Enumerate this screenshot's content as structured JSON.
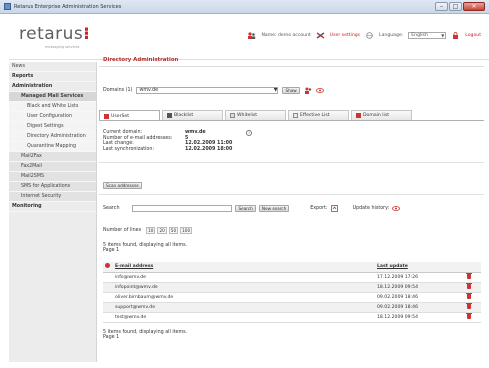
{
  "window": {
    "title": "Retarus Enterprise Administration Services"
  },
  "logo": {
    "name": "retarus",
    "sub": "messaging services"
  },
  "topbar": {
    "name_label": "Name: demo account",
    "user_settings": "User settings",
    "language_label": "Language:",
    "language_value": "English",
    "logout": "Logout"
  },
  "sidebar": {
    "items": [
      {
        "label": "News"
      },
      {
        "label": "Reports"
      },
      {
        "label": "Administration"
      },
      {
        "label": "Managed Mail Services"
      },
      {
        "label": "Black and White Lists"
      },
      {
        "label": "User Configuration"
      },
      {
        "label": "Digest Settings"
      },
      {
        "label": "Directory Administration"
      },
      {
        "label": "Quarantine Mapping"
      },
      {
        "label": "Mail2Fax"
      },
      {
        "label": "Fax2Mail"
      },
      {
        "label": "Mail2SMS"
      },
      {
        "label": "SMS for Applications"
      },
      {
        "label": "Internet Security"
      },
      {
        "label": "Monitoring"
      }
    ]
  },
  "main": {
    "title": "Directory Administration",
    "domains_label": "Domains (1)",
    "domain_value": "wmv.de",
    "show_button": "Show",
    "tabs": [
      {
        "label": "UserSet"
      },
      {
        "label": "Blacklist"
      },
      {
        "label": "Whitelist"
      },
      {
        "label": "Effective List"
      },
      {
        "label": "Domain list"
      }
    ],
    "info": {
      "current_domain_label": "Current domain:",
      "current_domain": "wmv.de",
      "count_label": "Number of e-mail addresses:",
      "count": "5",
      "last_change_label": "Last change:",
      "last_change": "12.02.2009 11:00",
      "last_sync_label": "Last synchronization:",
      "last_sync": "12.02.2009 18:00"
    },
    "scan_button": "Scan addresses",
    "search_label": "Search",
    "search_button": "Search",
    "new_search_button": "New search",
    "export_label": "Export:",
    "update_history_label": "Update history:",
    "lines_label": "Number of lines",
    "lines": [
      "10",
      "20",
      "50",
      "100"
    ],
    "found_text": "5 items found, displaying all items.",
    "page_text": "Page 1",
    "table": {
      "headers": [
        "E-mail address",
        "Last update"
      ],
      "rows": [
        {
          "email": "info@wmv.de",
          "date": "17.12.2009 17:26"
        },
        {
          "email": "infopoint@wmv.de",
          "date": "18.12.2009 09:54"
        },
        {
          "email": "oliver.birnbaum@wmv.de",
          "date": "09.02.2009 18:46"
        },
        {
          "email": "support@wmv.de",
          "date": "09.02.2009 18:46"
        },
        {
          "email": "test@wmv.de",
          "date": "18.12.2009 09:54"
        }
      ]
    }
  },
  "colors": {
    "accent": "#b03030",
    "sidebar_bg": "#ececec"
  }
}
